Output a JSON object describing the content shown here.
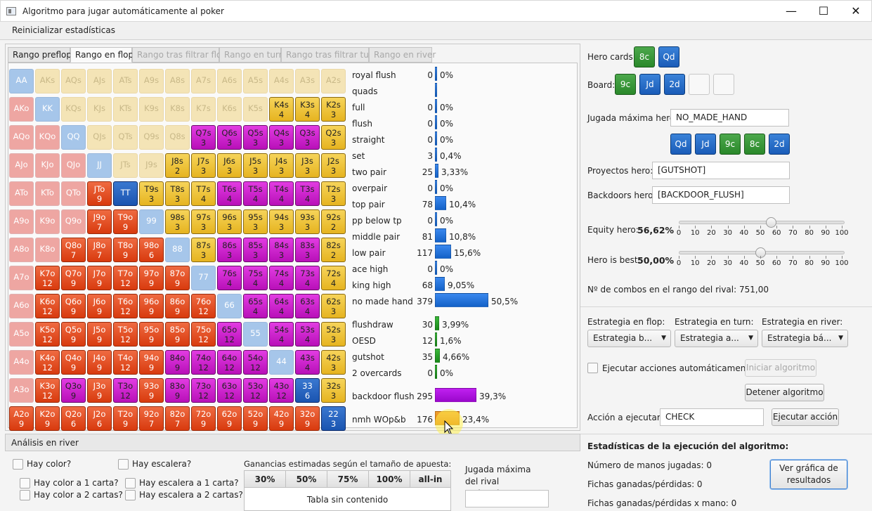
{
  "window": {
    "title": "Algoritmo para jugar automáticamente al poker",
    "minimize": "—",
    "maximize": "☐",
    "close": "✕"
  },
  "menu": {
    "reset": "Reinicializar estadísticas"
  },
  "tabs": [
    "Rango preflop",
    "Rango en flop",
    "Rango tras filtrar flop",
    "Rango en turn",
    "Rango tras filtrar turn",
    "Rango en river"
  ],
  "grid": [
    [
      [
        "AA",
        "",
        "lb"
      ],
      [
        "AKs",
        "",
        "ly"
      ],
      [
        "AQs",
        "",
        "ly"
      ],
      [
        "AJs",
        "",
        "ly"
      ],
      [
        "ATs",
        "",
        "ly"
      ],
      [
        "A9s",
        "",
        "ly"
      ],
      [
        "A8s",
        "",
        "ly"
      ],
      [
        "A7s",
        "",
        "ly"
      ],
      [
        "A6s",
        "",
        "ly"
      ],
      [
        "A5s",
        "",
        "ly"
      ],
      [
        "A4s",
        "",
        "ly"
      ],
      [
        "A3s",
        "",
        "ly"
      ],
      [
        "A2s",
        "",
        "ly"
      ]
    ],
    [
      [
        "AKo",
        "",
        "lr"
      ],
      [
        "KK",
        "",
        "lb"
      ],
      [
        "KQs",
        "",
        "ly"
      ],
      [
        "KJs",
        "",
        "ly"
      ],
      [
        "KTs",
        "",
        "ly"
      ],
      [
        "K9s",
        "",
        "ly"
      ],
      [
        "K8s",
        "",
        "ly"
      ],
      [
        "K7s",
        "",
        "ly"
      ],
      [
        "K6s",
        "",
        "ly"
      ],
      [
        "K5s",
        "",
        "ly"
      ],
      [
        "K4s",
        "4",
        "y"
      ],
      [
        "K3s",
        "4",
        "y"
      ],
      [
        "K2s",
        "3",
        "y"
      ]
    ],
    [
      [
        "AQo",
        "",
        "lr"
      ],
      [
        "KQo",
        "",
        "lr"
      ],
      [
        "QQ",
        "",
        "lb"
      ],
      [
        "QJs",
        "",
        "ly"
      ],
      [
        "QTs",
        "",
        "ly"
      ],
      [
        "Q9s",
        "",
        "ly"
      ],
      [
        "Q8s",
        "",
        "ly"
      ],
      [
        "Q7s",
        "3",
        "m"
      ],
      [
        "Q6s",
        "3",
        "m"
      ],
      [
        "Q5s",
        "3",
        "m"
      ],
      [
        "Q4s",
        "3",
        "m"
      ],
      [
        "Q3s",
        "3",
        "m"
      ],
      [
        "Q2s",
        "3",
        "y"
      ]
    ],
    [
      [
        "AJo",
        "",
        "lr"
      ],
      [
        "KJo",
        "",
        "lr"
      ],
      [
        "QJo",
        "",
        "lr"
      ],
      [
        "JJ",
        "",
        "lb"
      ],
      [
        "JTs",
        "",
        "ly"
      ],
      [
        "J9s",
        "",
        "ly"
      ],
      [
        "J8s",
        "2",
        "y"
      ],
      [
        "J7s",
        "3",
        "y"
      ],
      [
        "J6s",
        "3",
        "y"
      ],
      [
        "J5s",
        "3",
        "y"
      ],
      [
        "J4s",
        "3",
        "y"
      ],
      [
        "J3s",
        "3",
        "y"
      ],
      [
        "J2s",
        "3",
        "y"
      ]
    ],
    [
      [
        "ATo",
        "",
        "lr"
      ],
      [
        "KTo",
        "",
        "lr"
      ],
      [
        "QTo",
        "",
        "lr"
      ],
      [
        "JTo",
        "9",
        "o"
      ],
      [
        "TT",
        "",
        "b"
      ],
      [
        "T9s",
        "3",
        "y"
      ],
      [
        "T8s",
        "3",
        "y"
      ],
      [
        "T7s",
        "4",
        "y"
      ],
      [
        "T6s",
        "4",
        "m"
      ],
      [
        "T5s",
        "4",
        "m"
      ],
      [
        "T4s",
        "4",
        "m"
      ],
      [
        "T3s",
        "4",
        "m"
      ],
      [
        "T2s",
        "3",
        "y"
      ]
    ],
    [
      [
        "A9o",
        "",
        "lr"
      ],
      [
        "K9o",
        "",
        "lr"
      ],
      [
        "Q9o",
        "",
        "lr"
      ],
      [
        "J9o",
        "7",
        "o"
      ],
      [
        "T9o",
        "9",
        "o"
      ],
      [
        "99",
        "",
        "lb"
      ],
      [
        "98s",
        "3",
        "y"
      ],
      [
        "97s",
        "3",
        "y"
      ],
      [
        "96s",
        "3",
        "y"
      ],
      [
        "95s",
        "3",
        "y"
      ],
      [
        "94s",
        "3",
        "y"
      ],
      [
        "93s",
        "3",
        "y"
      ],
      [
        "92s",
        "2",
        "y"
      ]
    ],
    [
      [
        "A8o",
        "",
        "lr"
      ],
      [
        "K8o",
        "",
        "lr"
      ],
      [
        "Q8o",
        "7",
        "o"
      ],
      [
        "J8o",
        "7",
        "o"
      ],
      [
        "T8o",
        "9",
        "o"
      ],
      [
        "98o",
        "6",
        "o"
      ],
      [
        "88",
        "",
        "lb"
      ],
      [
        "87s",
        "3",
        "y"
      ],
      [
        "86s",
        "3",
        "m"
      ],
      [
        "85s",
        "3",
        "m"
      ],
      [
        "84s",
        "3",
        "m"
      ],
      [
        "83s",
        "3",
        "m"
      ],
      [
        "82s",
        "2",
        "y"
      ]
    ],
    [
      [
        "A7o",
        "",
        "lr"
      ],
      [
        "K7o",
        "12",
        "o"
      ],
      [
        "Q7o",
        "9",
        "o"
      ],
      [
        "J7o",
        "9",
        "o"
      ],
      [
        "T7o",
        "12",
        "o"
      ],
      [
        "97o",
        "9",
        "o"
      ],
      [
        "87o",
        "9",
        "o"
      ],
      [
        "77",
        "",
        "lb"
      ],
      [
        "76s",
        "4",
        "m"
      ],
      [
        "75s",
        "4",
        "m"
      ],
      [
        "74s",
        "4",
        "m"
      ],
      [
        "73s",
        "4",
        "m"
      ],
      [
        "72s",
        "4",
        "y"
      ]
    ],
    [
      [
        "A6o",
        "",
        "lr"
      ],
      [
        "K6o",
        "12",
        "o"
      ],
      [
        "Q6o",
        "9",
        "o"
      ],
      [
        "J6o",
        "9",
        "o"
      ],
      [
        "T6o",
        "12",
        "o"
      ],
      [
        "96o",
        "9",
        "o"
      ],
      [
        "86o",
        "9",
        "o"
      ],
      [
        "76o",
        "12",
        "o"
      ],
      [
        "66",
        "",
        "lb"
      ],
      [
        "65s",
        "4",
        "m"
      ],
      [
        "64s",
        "4",
        "m"
      ],
      [
        "63s",
        "4",
        "m"
      ],
      [
        "62s",
        "3",
        "y"
      ]
    ],
    [
      [
        "A5o",
        "",
        "lr"
      ],
      [
        "K5o",
        "12",
        "o"
      ],
      [
        "Q5o",
        "9",
        "o"
      ],
      [
        "J5o",
        "9",
        "o"
      ],
      [
        "T5o",
        "12",
        "o"
      ],
      [
        "95o",
        "9",
        "o"
      ],
      [
        "85o",
        "9",
        "o"
      ],
      [
        "75o",
        "12",
        "o"
      ],
      [
        "65o",
        "12",
        "m"
      ],
      [
        "55",
        "",
        "lb"
      ],
      [
        "54s",
        "4",
        "m"
      ],
      [
        "53s",
        "4",
        "m"
      ],
      [
        "52s",
        "3",
        "y"
      ]
    ],
    [
      [
        "A4o",
        "",
        "lr"
      ],
      [
        "K4o",
        "12",
        "o"
      ],
      [
        "Q4o",
        "9",
        "o"
      ],
      [
        "J4o",
        "9",
        "o"
      ],
      [
        "T4o",
        "12",
        "o"
      ],
      [
        "94o",
        "9",
        "o"
      ],
      [
        "84o",
        "9",
        "m"
      ],
      [
        "74o",
        "12",
        "m"
      ],
      [
        "64o",
        "12",
        "m"
      ],
      [
        "54o",
        "12",
        "m"
      ],
      [
        "44",
        "",
        "lb"
      ],
      [
        "43s",
        "4",
        "m"
      ],
      [
        "42s",
        "3",
        "y"
      ]
    ],
    [
      [
        "A3o",
        "",
        "lr"
      ],
      [
        "K3o",
        "12",
        "o"
      ],
      [
        "Q3o",
        "9",
        "m"
      ],
      [
        "J3o",
        "9",
        "o"
      ],
      [
        "T3o",
        "12",
        "m"
      ],
      [
        "93o",
        "9",
        "o"
      ],
      [
        "83o",
        "9",
        "m"
      ],
      [
        "73o",
        "12",
        "m"
      ],
      [
        "63o",
        "12",
        "m"
      ],
      [
        "53o",
        "12",
        "m"
      ],
      [
        "43o",
        "12",
        "m"
      ],
      [
        "33",
        "6",
        "b"
      ],
      [
        "32s",
        "3",
        "y"
      ]
    ],
    [
      [
        "A2o",
        "9",
        "o"
      ],
      [
        "K2o",
        "9",
        "o"
      ],
      [
        "Q2o",
        "6",
        "o"
      ],
      [
        "J2o",
        "6",
        "o"
      ],
      [
        "T2o",
        "9",
        "o"
      ],
      [
        "92o",
        "7",
        "o"
      ],
      [
        "82o",
        "7",
        "o"
      ],
      [
        "72o",
        "9",
        "o"
      ],
      [
        "62o",
        "9",
        "o"
      ],
      [
        "52o",
        "9",
        "o"
      ],
      [
        "42o",
        "9",
        "o"
      ],
      [
        "32o",
        "9",
        "o"
      ],
      [
        "22",
        "3",
        "b"
      ]
    ]
  ],
  "stats": [
    {
      "label": "royal flush",
      "count": "0",
      "pct": "0%",
      "value": 0,
      "color": "blue"
    },
    {
      "label": "quads",
      "count": "",
      "pct": "",
      "value": 0,
      "color": "blue"
    },
    {
      "label": "full",
      "count": "0",
      "pct": "0%",
      "value": 0,
      "color": "blue"
    },
    {
      "label": "flush",
      "count": "0",
      "pct": "0%",
      "value": 0,
      "color": "blue"
    },
    {
      "label": "straight",
      "count": "0",
      "pct": "0%",
      "value": 0,
      "color": "blue"
    },
    {
      "label": "set",
      "count": "3",
      "pct": "0,4%",
      "value": 0.4,
      "color": "blue"
    },
    {
      "label": "two pair",
      "count": "25",
      "pct": "3,33%",
      "value": 3.33,
      "color": "blue"
    },
    {
      "label": "overpair",
      "count": "0",
      "pct": "0%",
      "value": 0,
      "color": "blue"
    },
    {
      "label": "top pair",
      "count": "78",
      "pct": "10,4%",
      "value": 10.4,
      "color": "blue"
    },
    {
      "label": "pp below tp",
      "count": "0",
      "pct": "0%",
      "value": 0,
      "color": "blue"
    },
    {
      "label": "middle pair",
      "count": "81",
      "pct": "10,8%",
      "value": 10.8,
      "color": "blue"
    },
    {
      "label": "low pair",
      "count": "117",
      "pct": "15,6%",
      "value": 15.6,
      "color": "blue"
    },
    {
      "label": "ace high",
      "count": "0",
      "pct": "0%",
      "value": 0,
      "color": "blue"
    },
    {
      "label": "king high",
      "count": "68",
      "pct": "9,05%",
      "value": 9.05,
      "color": "blue"
    },
    {
      "label": "no made hand",
      "count": "379",
      "pct": "50,5%",
      "value": 50.5,
      "color": "blue"
    },
    {
      "label": "flushdraw",
      "count": "30",
      "pct": "3,99%",
      "value": 3.99,
      "color": "green"
    },
    {
      "label": "OESD",
      "count": "12",
      "pct": "1,6%",
      "value": 1.6,
      "color": "green"
    },
    {
      "label": "gutshot",
      "count": "35",
      "pct": "4,66%",
      "value": 4.66,
      "color": "green"
    },
    {
      "label": "2 overcards",
      "count": "0",
      "pct": "0%",
      "value": 0,
      "color": "green"
    },
    {
      "label": "backdoor flush",
      "count": "295",
      "pct": "39,3%",
      "value": 39.3,
      "color": "purple"
    },
    {
      "label": "nmh WOp&b",
      "count": "176",
      "pct": "23,4%",
      "value": 23.4,
      "color": "orange"
    }
  ],
  "river": {
    "title": "Análisis en river",
    "hay_color": "Hay color?",
    "hay_escalera": "Hay escalera?",
    "color1": "Hay color a 1 carta?",
    "color2": "Hay color a 2 cartas?",
    "esc1": "Hay escalera a 1 carta?",
    "esc2": "Hay escalera a 2 cartas?",
    "ganancias": "Ganancias estimadas según el tamaño de apuesta:",
    "cols": [
      "30%",
      "50%",
      "75%",
      "100%",
      "all-in"
    ],
    "empty": "Tabla sin contenido",
    "jugada_rival": "Jugada máxima del rival estimada:"
  },
  "right": {
    "hero_cards_label": "Hero cards:",
    "hero_cards": [
      "8c",
      "Qd"
    ],
    "board_label": "Board:",
    "board": [
      "9c",
      "Jd",
      "2d"
    ],
    "jugada_label": "Jugada máxima hero:",
    "jugada": "NO_MADE_HAND",
    "jugada_cards": [
      "Qd",
      "Jd",
      "9c",
      "8c",
      "2d"
    ],
    "proyectos_label": "Proyectos hero:",
    "proyectos": "[GUTSHOT]",
    "backdoors_label": "Backdoors hero:",
    "backdoors": "[BACKDOOR_FLUSH]",
    "equity_label": "Equity hero:",
    "equity": "56,62%",
    "equity_value": 56.62,
    "best_label": "Hero is best:",
    "best": "50,00%",
    "best_value": 50,
    "ticks": [
      "0",
      "10",
      "20",
      "30",
      "40",
      "50",
      "60",
      "70",
      "80",
      "90",
      "100"
    ],
    "combos": "Nº de combos en el rango del rival: 751,00",
    "strat_flop_label": "Estrategia en flop:",
    "strat_flop": "Estrategia b...",
    "strat_turn_label": "Estrategia en turn:",
    "strat_turn": "Estrategia a...",
    "strat_river_label": "Estrategia en river:",
    "strat_river": "Estrategia bá...",
    "auto_label": "Ejecutar acciones automáticamente?",
    "iniciar": "Iniciar algoritmo",
    "detener": "Detener algoritmo",
    "accion_label": "Acción a ejecutar:",
    "accion": "CHECK",
    "ejecutar": "Ejecutar acción",
    "stats_title": "Estadísticas de la ejecución del algoritmo:",
    "manos": "Número de manos jugadas: 0",
    "fichas": "Fichas ganadas/pérdidas: 0",
    "fichas_mano": "Fichas ganadas/pérdidas x mano: 0",
    "grafica": "Ver gráfica de resultados"
  },
  "colors": {
    "orange": "#e04a1a",
    "yellow": "#eec236",
    "magenta": "#cc20cc",
    "blue": "#2a66c4",
    "bar_blue": "#1e74dc"
  }
}
